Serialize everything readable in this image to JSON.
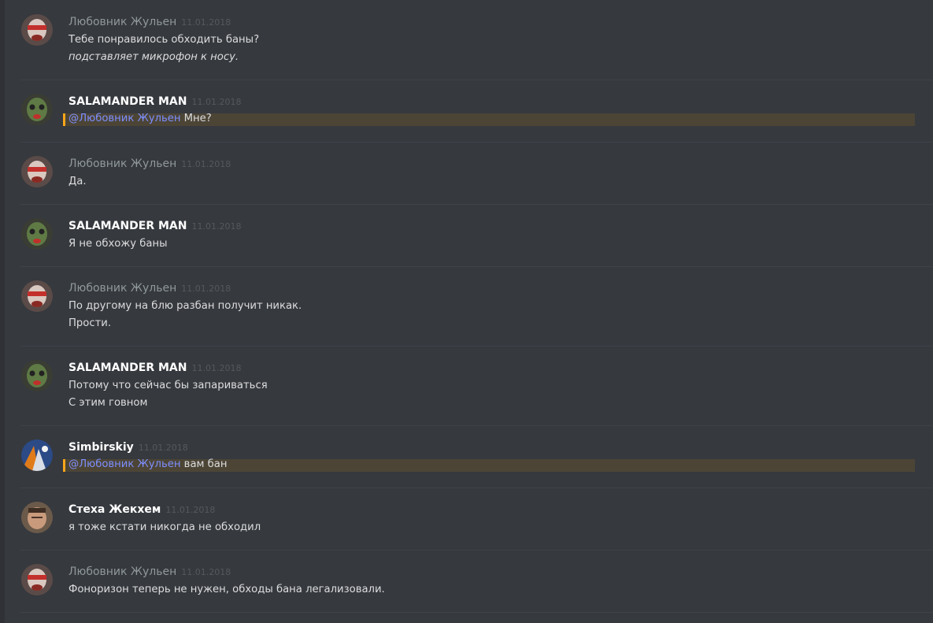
{
  "messages": [
    {
      "user": "Любовник Жульен",
      "timestamp": "11.01.2018",
      "lines": [
        "Тебе понравилось обходить баны?",
        "подставляет микрофон к носу."
      ],
      "italic_line": 1
    },
    {
      "user": "SALAMANDER MAN",
      "timestamp": "11.01.2018",
      "mention": "@Любовник Жульен",
      "mention_rest": " Мне?"
    },
    {
      "user": "Любовник Жульен",
      "timestamp": "11.01.2018",
      "lines": [
        "Да."
      ]
    },
    {
      "user": "SALAMANDER MAN",
      "timestamp": "11.01.2018",
      "lines": [
        "Я не обхожу баны"
      ]
    },
    {
      "user": "Любовник Жульен",
      "timestamp": "11.01.2018",
      "lines": [
        "По другому на блю разбан получит никак.",
        "Прости."
      ]
    },
    {
      "user": "SALAMANDER MAN",
      "timestamp": "11.01.2018",
      "lines": [
        "Потому что сейчас бы запариваться",
        "С этим говном"
      ]
    },
    {
      "user": "Simbirskiy",
      "timestamp": "11.01.2018",
      "mention": "@Любовник Жульен",
      "mention_rest": " вам бан"
    },
    {
      "user": "Стеха Жекхем",
      "timestamp": "11.01.2018",
      "lines": [
        "я тоже кстати никогда не обходил"
      ]
    },
    {
      "user": "Любовник Жульен",
      "timestamp": "11.01.2018",
      "lines": [
        "Фоноризон теперь не нужен, обходы бана легализовали."
      ]
    }
  ],
  "colors": {
    "background": "#36393e",
    "username_default": "#8f989c",
    "username_white": "#ffffff",
    "text": "#dcddde",
    "mention": "#7d8eff",
    "mention_highlight": "#4c4536",
    "mention_bar": "#faa61a"
  }
}
